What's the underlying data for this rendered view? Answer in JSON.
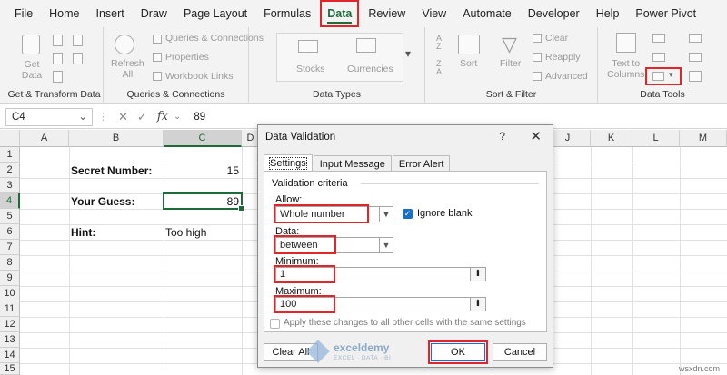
{
  "menu": [
    "File",
    "Home",
    "Insert",
    "Draw",
    "Page Layout",
    "Formulas",
    "Data",
    "Review",
    "View",
    "Automate",
    "Developer",
    "Help",
    "Power Pivot"
  ],
  "ribbon": {
    "get_transform": {
      "get_data": "Get Data",
      "label": "Get & Transform Data"
    },
    "queries": {
      "refresh": "Refresh",
      "all": "All",
      "queries_connections": "Queries & Connections",
      "properties": "Properties",
      "workbook_links": "Workbook Links",
      "label": "Queries & Connections"
    },
    "data_types": {
      "stocks": "Stocks",
      "currencies": "Currencies",
      "label": "Data Types"
    },
    "sort_filter": {
      "sort": "Sort",
      "filter": "Filter",
      "clear": "Clear",
      "reapply": "Reapply",
      "advanced": "Advanced",
      "label": "Sort & Filter"
    },
    "data_tools": {
      "text_to": "Text to",
      "columns": "Columns",
      "label": "Data Tools"
    }
  },
  "formula_bar": {
    "name_box": "C4",
    "value": "89"
  },
  "sheet": {
    "columns": [
      "A",
      "B",
      "C",
      "D",
      "J",
      "K",
      "L",
      "M"
    ],
    "rows": [
      "1",
      "2",
      "3",
      "4",
      "5",
      "6",
      "7",
      "8",
      "9",
      "10",
      "11",
      "12",
      "13",
      "14",
      "15"
    ],
    "b2": "Secret Number:",
    "c2": "15",
    "b4": "Your Guess:",
    "c4": "89",
    "b6": "Hint:",
    "c6": "Too high"
  },
  "dialog": {
    "title": "Data Validation",
    "help": "?",
    "tabs": [
      "Settings",
      "Input Message",
      "Error Alert"
    ],
    "criteria": "Validation criteria",
    "allow_label": "Allow:",
    "allow_value": "Whole number",
    "ignore_blank": "Ignore blank",
    "data_label": "Data:",
    "data_value": "between",
    "min_label": "Minimum:",
    "min_value": "1",
    "max_label": "Maximum:",
    "max_value": "100",
    "apply_all": "Apply these changes to all other cells with the same settings",
    "clear_all": "Clear All",
    "ok": "OK",
    "cancel": "Cancel"
  },
  "watermark": {
    "name": "exceldemy",
    "sub": "EXCEL · DATA · BI"
  },
  "footer": "wsxdn.com",
  "colors": {
    "accent": "#1d6b3a",
    "highlight": "#e0262b",
    "checkbox": "#1a6fc7"
  }
}
